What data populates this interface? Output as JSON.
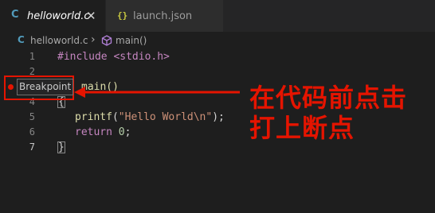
{
  "tabs": [
    {
      "icon": "C",
      "label": "helloworld.c",
      "close": "✕"
    },
    {
      "icon": "{}",
      "label": "launch.json"
    }
  ],
  "breadcrumb": {
    "file_icon": "C",
    "file": "helloworld.c",
    "separator": "›",
    "symbol": "main()"
  },
  "lines": [
    {
      "n": "1"
    },
    {
      "n": "2"
    },
    {
      "n": "3"
    },
    {
      "n": "4"
    },
    {
      "n": "5"
    },
    {
      "n": "6"
    },
    {
      "n": "7"
    }
  ],
  "code": {
    "include": "#include <stdio.h>",
    "main_fn": "main()",
    "open_brace": "{",
    "printf_fn": "printf",
    "printf_open": "(",
    "printf_str": "\"Hello World\\n\"",
    "printf_close": ");",
    "return_kw": "return",
    "return_val": "0",
    "return_semi": ";",
    "close_brace": "}"
  },
  "breakpoint": {
    "label": "Breakpoint"
  },
  "annotation": {
    "line1": "在代码前点击",
    "line2": "打上断点"
  },
  "colors": {
    "annotation": "#e51400",
    "background": "#1e1e1e"
  }
}
